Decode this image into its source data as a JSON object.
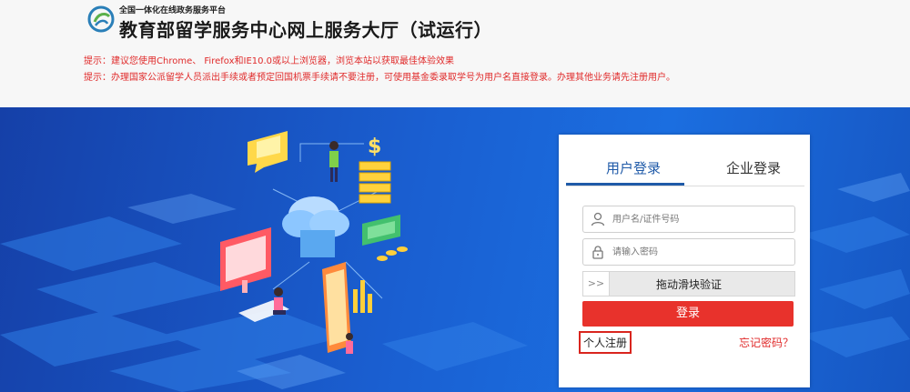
{
  "header": {
    "platform_name": "全国一体化在线政务服务平台",
    "title": "教育部留学服务中心网上服务大厅（试运行）",
    "tips": [
      "提示：建议您使用Chrome、 Firefox和IE10.0或以上浏览器，浏览本站以获取最佳体验效果",
      "提示：办理国家公派留学人员派出手续或者预定回国机票手续请不要注册，可使用基金委录取学号为用户名直接登录。办理其他业务请先注册用户。"
    ],
    "tip_color": "#e02a2a"
  },
  "login": {
    "tabs": [
      {
        "label": "用户登录",
        "active": true
      },
      {
        "label": "企业登录",
        "active": false
      }
    ],
    "username_placeholder": "用户名/证件号码",
    "password_placeholder": "请输入密码",
    "slider_handle": ">>",
    "slider_text": "拖动滑块验证",
    "login_button": "登录",
    "register_link": "个人注册",
    "forgot_link": "忘记密码？",
    "accent_color": "#1f5aa8",
    "button_color": "#e8322c"
  },
  "icons": {
    "logo": "ministry-logo-icon",
    "user": "user-icon",
    "lock": "lock-icon"
  }
}
